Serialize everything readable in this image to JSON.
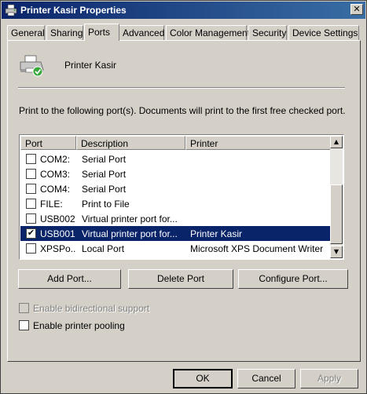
{
  "window": {
    "title": "Printer Kasir Properties",
    "close_glyph": "✕"
  },
  "tabs": [
    {
      "label": "General"
    },
    {
      "label": "Sharing"
    },
    {
      "label": "Ports",
      "active": true
    },
    {
      "label": "Advanced"
    },
    {
      "label": "Color Management"
    },
    {
      "label": "Security"
    },
    {
      "label": "Device Settings"
    }
  ],
  "printer": {
    "name": "Printer Kasir",
    "icon": "printer-shared-icon"
  },
  "instructions": "Print to the following port(s). Documents will print to the first free checked port.",
  "ports_table": {
    "columns": [
      "Port",
      "Description",
      "Printer"
    ],
    "rows": [
      {
        "port": "COM2:",
        "description": "Serial Port",
        "printer": "",
        "checked": false
      },
      {
        "port": "COM3:",
        "description": "Serial Port",
        "printer": "",
        "checked": false
      },
      {
        "port": "COM4:",
        "description": "Serial Port",
        "printer": "",
        "checked": false
      },
      {
        "port": "FILE:",
        "description": "Print to File",
        "printer": "",
        "checked": false
      },
      {
        "port": "USB002",
        "description": "Virtual printer port for...",
        "printer": "",
        "checked": false
      },
      {
        "port": "USB001",
        "description": "Virtual printer port for...",
        "printer": "Printer Kasir",
        "checked": true,
        "selected": true
      },
      {
        "port": "XPSPo...",
        "description": "Local Port",
        "printer": "Microsoft XPS Document Writer",
        "checked": false
      }
    ],
    "check_glyph": "✔",
    "scroll_up_glyph": "▲",
    "scroll_down_glyph": "▼"
  },
  "port_buttons": {
    "add": "Add Port...",
    "delete": "Delete Port",
    "configure": "Configure Port..."
  },
  "options": {
    "bidirectional": {
      "label": "Enable bidirectional support",
      "enabled": false,
      "checked": false
    },
    "pooling": {
      "label": "Enable printer pooling",
      "enabled": true,
      "checked": false
    }
  },
  "dialog_buttons": {
    "ok": "OK",
    "cancel": "Cancel",
    "apply": "Apply"
  },
  "colors": {
    "title_start": "#0a246a",
    "title_end": "#3a6ea5",
    "selection": "#0a246a",
    "face": "#d4d0c8"
  }
}
